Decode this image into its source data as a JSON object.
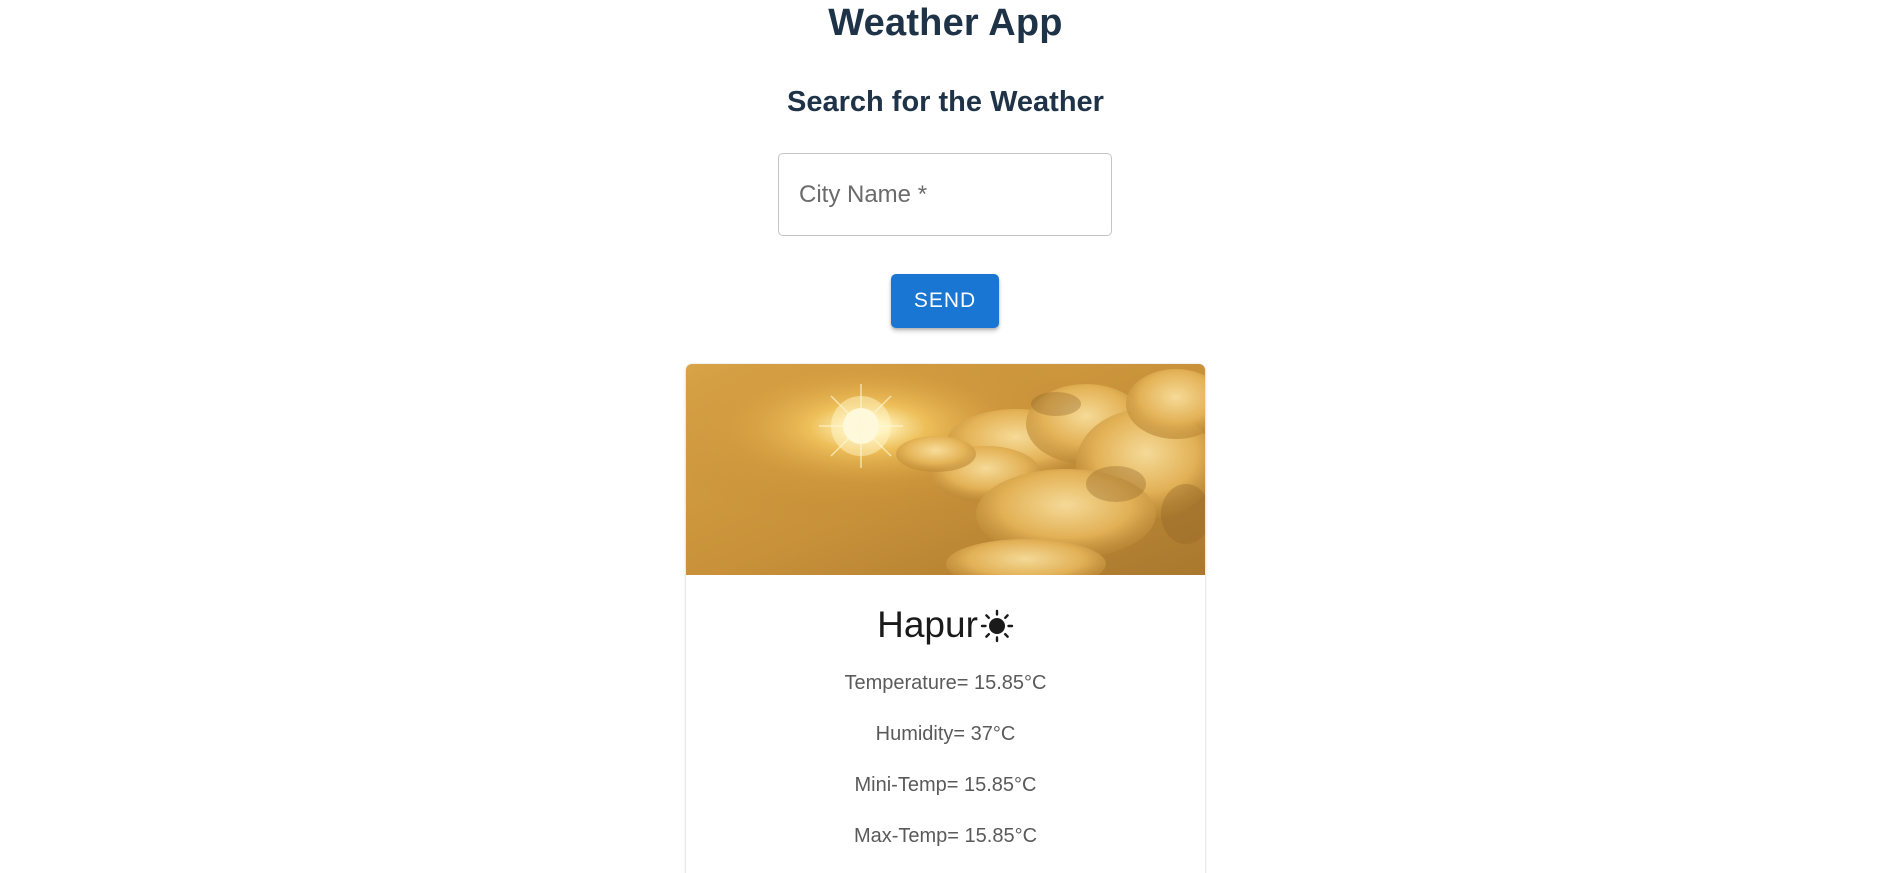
{
  "header": {
    "title": "Weather App",
    "subtitle": "Search for the Weather"
  },
  "search": {
    "placeholder": "City Name *",
    "value": "",
    "send_label": "SEND"
  },
  "weather": {
    "city": "Hapur",
    "icon": "sun-icon",
    "temperature": "Temperature= 15.85°C",
    "humidity": "Humidity= 37°C",
    "min_temp": "Mini-Temp= 15.85°C",
    "max_temp": "Max-Temp= 15.85°C"
  },
  "colors": {
    "heading": "#1e3348",
    "button": "#1976d2",
    "stat_text": "#5a5a5a"
  }
}
